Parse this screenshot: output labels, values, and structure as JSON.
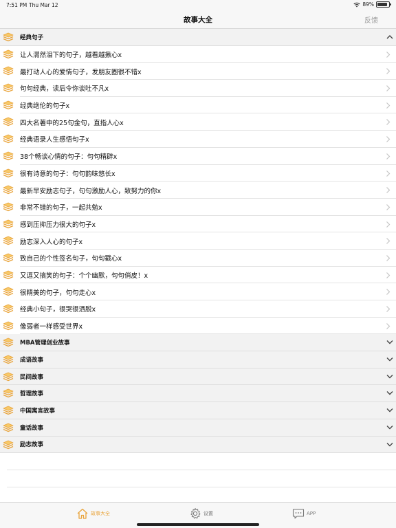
{
  "status_bar": {
    "time": "7:51 PM",
    "date": "Thu Mar 12",
    "battery": "89%",
    "battery_level": 0.89
  },
  "nav": {
    "title": "故事大全",
    "right_button": "反馈"
  },
  "sections": [
    {
      "title": "经典句子",
      "expanded": true,
      "items": [
        "让人潸然泪下的句子，越看越揪心x",
        "最打动人心的爱情句子，发朋友圈很不错x",
        "句句经典，读后令你谈吐不凡x",
        "经典绝伦的句子x",
        "四大名著中的25句金句，直指人心x",
        "经典语录人生感悟句子x",
        "38个畅谈心情的句子：句句精辟x",
        "很有诗意的句子：句句韵味悠长x",
        "最新早安励志句子，句句激励人心，致努力的你x",
        "非常不错的句子，一起共勉x",
        "感到压抑压力很大的句子x",
        "励志深入人心的句子x",
        "致自己的个性签名句子，句句戳心x",
        "又逗又搞笑的句子：个个幽默，句句俏皮！x",
        "很精美的句子，句句走心x",
        "经典小句子，很哭很洒脱x",
        "像弱者一样感受世界x"
      ]
    },
    {
      "title": "MBA管理创业故事",
      "expanded": false,
      "items": []
    },
    {
      "title": "成语故事",
      "expanded": false,
      "items": []
    },
    {
      "title": "民间故事",
      "expanded": false,
      "items": []
    },
    {
      "title": "哲理故事",
      "expanded": false,
      "items": []
    },
    {
      "title": "中国寓言故事",
      "expanded": false,
      "items": []
    },
    {
      "title": "童话故事",
      "expanded": false,
      "items": []
    },
    {
      "title": "励志故事",
      "expanded": false,
      "items": []
    }
  ],
  "tabs": [
    {
      "label": "故事大全",
      "icon": "home-icon",
      "active": true
    },
    {
      "label": "设置",
      "icon": "gear-icon",
      "active": false
    },
    {
      "label": "APP",
      "icon": "chat-icon",
      "active": false
    }
  ],
  "colors": {
    "accent": "#e9a43b",
    "book_dark": "#e9a43b",
    "book_light": "#f7c96a"
  }
}
